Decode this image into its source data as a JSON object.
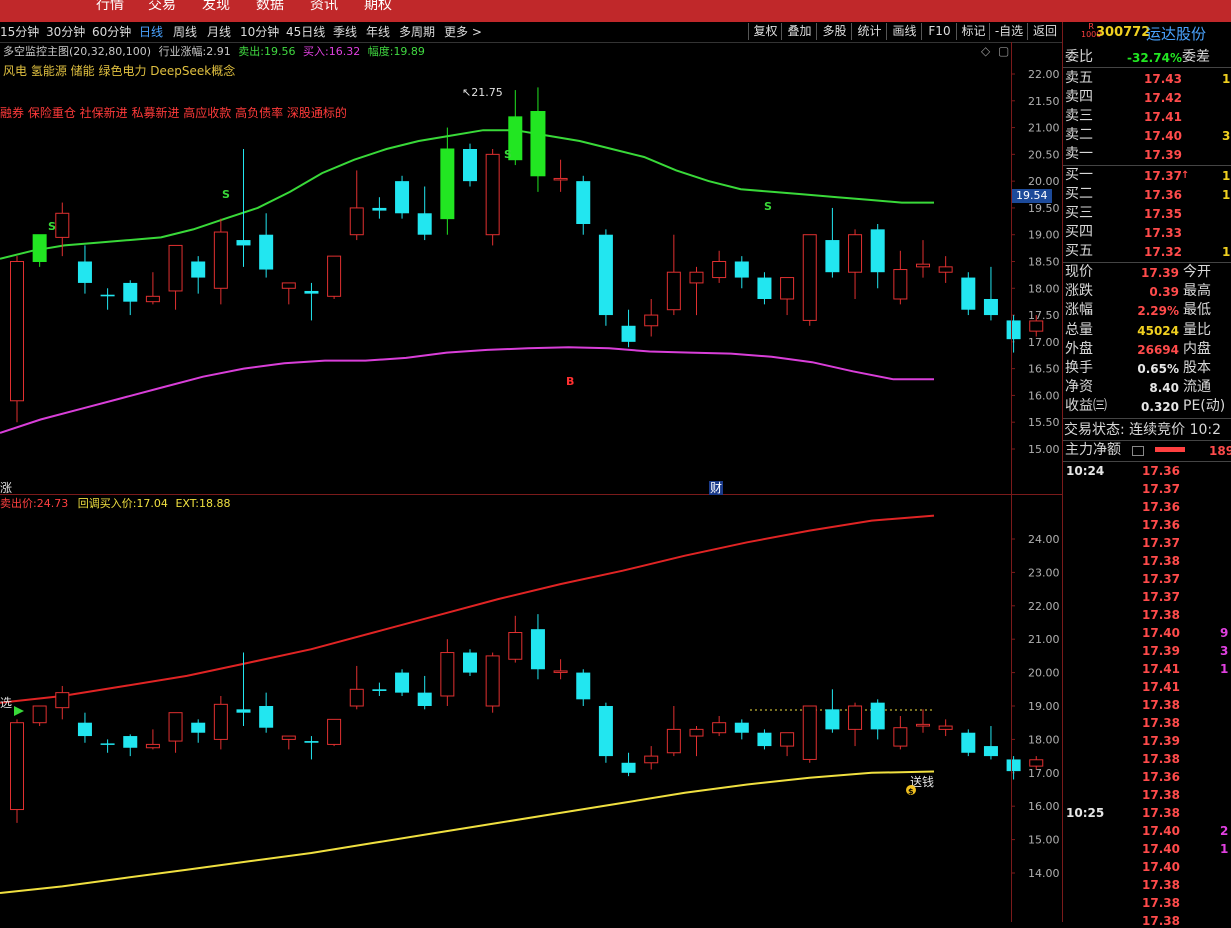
{
  "top_nav": {
    "items": [
      "行情",
      "交易",
      "发现",
      "数据",
      "资讯",
      "期权"
    ]
  },
  "periods": [
    "15分钟",
    "30分钟",
    "60分钟",
    "日线",
    "周线",
    "月线",
    "10分钟",
    "45日线",
    "季线",
    "年线",
    "多周期",
    "更多 >"
  ],
  "active_period": "日线",
  "tools": [
    "复权",
    "叠加",
    "多股",
    "统计",
    "画线",
    "F10",
    "标记",
    "-自选",
    "返回"
  ],
  "main_chart": {
    "indicator_name": "多空监控主图(20,32,80,100)",
    "indicator_rise_label": "行业涨幅:",
    "indicator_rise_value": "2.91",
    "sell_label": "卖出:",
    "sell_value": "19.56",
    "buy_label": "买入:",
    "buy_value": "16.32",
    "range_label": "幅度:",
    "range_value": "19.89",
    "concepts_line1": "风电 氢能源 储能 绿色电力 DeepSeek概念",
    "concepts_line2": "融券 保险重仓 社保新进 私募新进 高应收款 高负债率 深股通标的",
    "high_marker": "21.75",
    "current_price_tag": "19.54",
    "cai_marker": "财",
    "zhang_marker": "涨"
  },
  "sub_chart": {
    "sell_price_label": "卖出价:",
    "sell_price_value": "24.73",
    "pullback_label": "回调买入价:",
    "pullback_value": "17.04",
    "ext_label": "EXT:",
    "ext_value": "18.88",
    "pick_marker": "选",
    "money_marker": "送钱",
    "coin_marker": "$"
  },
  "chart_data": [
    {
      "type": "candlestick",
      "ylim": [
        14.6,
        22.3
      ],
      "yticks": [
        "22.00",
        "21.50",
        "21.00",
        "20.50",
        "20.00",
        "19.50",
        "19.00",
        "18.50",
        "18.00",
        "17.50",
        "17.00",
        "16.50",
        "16.00",
        "15.50",
        "15.00"
      ],
      "candles": [
        {
          "o": 15.9,
          "h": 18.6,
          "l": 15.5,
          "c": 18.5
        },
        {
          "o": 18.5,
          "h": 19.0,
          "l": 18.4,
          "c": 19.0
        },
        {
          "o": 18.95,
          "h": 19.6,
          "l": 18.6,
          "c": 19.4
        },
        {
          "o": 18.5,
          "h": 18.8,
          "l": 17.9,
          "c": 18.1
        },
        {
          "o": 17.88,
          "h": 18.0,
          "l": 17.6,
          "c": 17.85
        },
        {
          "o": 18.1,
          "h": 18.15,
          "l": 17.5,
          "c": 17.75
        },
        {
          "o": 17.75,
          "h": 18.3,
          "l": 17.7,
          "c": 17.85
        },
        {
          "o": 17.95,
          "h": 18.8,
          "l": 17.6,
          "c": 18.8
        },
        {
          "o": 18.5,
          "h": 18.6,
          "l": 17.9,
          "c": 18.2
        },
        {
          "o": 18.0,
          "h": 19.3,
          "l": 17.7,
          "c": 19.05
        },
        {
          "o": 18.9,
          "h": 20.6,
          "l": 18.4,
          "c": 18.8
        },
        {
          "o": 19.0,
          "h": 19.4,
          "l": 18.2,
          "c": 18.35
        },
        {
          "o": 18.0,
          "h": 18.1,
          "l": 17.7,
          "c": 18.1
        },
        {
          "o": 17.95,
          "h": 18.1,
          "l": 17.4,
          "c": 17.9
        },
        {
          "o": 17.85,
          "h": 18.6,
          "l": 17.8,
          "c": 18.6
        },
        {
          "o": 19.0,
          "h": 20.2,
          "l": 18.9,
          "c": 19.5
        },
        {
          "o": 19.5,
          "h": 19.7,
          "l": 19.3,
          "c": 19.45
        },
        {
          "o": 20.0,
          "h": 20.1,
          "l": 19.3,
          "c": 19.4
        },
        {
          "o": 19.4,
          "h": 19.9,
          "l": 18.9,
          "c": 19.0
        },
        {
          "o": 19.3,
          "h": 21.0,
          "l": 19.0,
          "c": 20.6
        },
        {
          "o": 20.6,
          "h": 20.7,
          "l": 19.9,
          "c": 20.0
        },
        {
          "o": 19.0,
          "h": 20.6,
          "l": 18.8,
          "c": 20.5
        },
        {
          "o": 20.4,
          "h": 21.7,
          "l": 20.3,
          "c": 21.2
        },
        {
          "o": 21.3,
          "h": 21.75,
          "l": 19.8,
          "c": 20.1
        },
        {
          "o": 20.05,
          "h": 20.4,
          "l": 19.8,
          "c": 20.05
        },
        {
          "o": 20.0,
          "h": 20.1,
          "l": 19.0,
          "c": 19.2
        },
        {
          "o": 19.0,
          "h": 19.1,
          "l": 17.3,
          "c": 17.5
        },
        {
          "o": 17.3,
          "h": 17.6,
          "l": 16.9,
          "c": 17.0
        },
        {
          "o": 17.3,
          "h": 17.8,
          "l": 17.1,
          "c": 17.5
        },
        {
          "o": 17.6,
          "h": 19.0,
          "l": 17.5,
          "c": 18.3
        },
        {
          "o": 18.1,
          "h": 18.4,
          "l": 17.5,
          "c": 18.3
        },
        {
          "o": 18.2,
          "h": 18.7,
          "l": 18.1,
          "c": 18.5
        },
        {
          "o": 18.5,
          "h": 18.6,
          "l": 18.0,
          "c": 18.2
        },
        {
          "o": 18.2,
          "h": 18.3,
          "l": 17.7,
          "c": 17.8
        },
        {
          "o": 17.8,
          "h": 18.2,
          "l": 17.5,
          "c": 18.2
        },
        {
          "o": 17.4,
          "h": 19.0,
          "l": 17.3,
          "c": 19.0
        },
        {
          "o": 18.9,
          "h": 19.5,
          "l": 18.2,
          "c": 18.3
        },
        {
          "o": 18.3,
          "h": 19.1,
          "l": 17.8,
          "c": 19.0
        },
        {
          "o": 19.1,
          "h": 19.2,
          "l": 18.0,
          "c": 18.3
        },
        {
          "o": 17.8,
          "h": 18.7,
          "l": 17.7,
          "c": 18.35
        },
        {
          "o": 18.4,
          "h": 18.9,
          "l": 18.2,
          "c": 18.45
        },
        {
          "o": 18.3,
          "h": 18.6,
          "l": 18.1,
          "c": 18.4
        },
        {
          "o": 18.2,
          "h": 18.3,
          "l": 17.5,
          "c": 17.6
        },
        {
          "o": 17.8,
          "h": 18.4,
          "l": 17.4,
          "c": 17.5
        },
        {
          "o": 17.4,
          "h": 17.5,
          "l": 16.8,
          "c": 17.05
        },
        {
          "o": 17.2,
          "h": 17.5,
          "l": 17.1,
          "c": 17.39
        }
      ],
      "series": [
        {
          "values": [
            18.55,
            18.7,
            18.8,
            18.85,
            18.9,
            18.95,
            19.1,
            19.3,
            19.5,
            19.8,
            20.15,
            20.4,
            20.6,
            20.75,
            20.85,
            20.95,
            20.95,
            20.85,
            20.75,
            20.6,
            20.45,
            20.2,
            20.0,
            19.85,
            19.8,
            19.75,
            19.7,
            19.65,
            19.6,
            19.6
          ]
        },
        {
          "values": [
            15.3,
            15.55,
            15.75,
            15.95,
            16.15,
            16.35,
            16.5,
            16.6,
            16.65,
            16.65,
            16.7,
            16.8,
            16.85,
            16.88,
            16.9,
            16.88,
            16.82,
            16.8,
            16.78,
            16.72,
            16.62,
            16.45,
            16.3,
            16.3
          ]
        }
      ],
      "markers": [
        "S",
        "S",
        "S",
        "S",
        "B"
      ]
    },
    {
      "type": "candlestick",
      "ylim": [
        13.3,
        25.0
      ],
      "yticks": [
        "24.00",
        "23.00",
        "22.00",
        "21.00",
        "20.00",
        "19.00",
        "18.00",
        "17.00",
        "16.00",
        "15.00",
        "14.00"
      ],
      "series": [
        {
          "name": "卖出价",
          "values": [
            19.1,
            19.3,
            19.6,
            19.9,
            20.3,
            20.7,
            21.2,
            21.7,
            22.2,
            22.65,
            23.05,
            23.5,
            23.9,
            24.25,
            24.55,
            24.7
          ]
        },
        {
          "name": "回调买入价",
          "values": [
            13.4,
            13.6,
            13.85,
            14.1,
            14.35,
            14.6,
            14.9,
            15.2,
            15.5,
            15.8,
            16.1,
            16.4,
            16.65,
            16.85,
            17.0,
            17.04
          ]
        }
      ],
      "ext_line": 18.88
    }
  ],
  "right_panel": {
    "code": "300772",
    "name": "运达股份",
    "r_mark": "R",
    "rank_mark": "1000",
    "wei_bi_label": "委比",
    "wei_bi_value": "-32.74%",
    "wei_cha_label": "委差",
    "asks": [
      {
        "label": "卖五",
        "price": "17.43",
        "vol": "1"
      },
      {
        "label": "卖四",
        "price": "17.42",
        "vol": ""
      },
      {
        "label": "卖三",
        "price": "17.41",
        "vol": ""
      },
      {
        "label": "卖二",
        "price": "17.40",
        "vol": "3"
      },
      {
        "label": "卖一",
        "price": "17.39",
        "vol": ""
      }
    ],
    "bids": [
      {
        "label": "买一",
        "price": "17.37",
        "vol": "1"
      },
      {
        "label": "买二",
        "price": "17.36",
        "vol": "1"
      },
      {
        "label": "买三",
        "price": "17.35",
        "vol": ""
      },
      {
        "label": "买四",
        "price": "17.33",
        "vol": ""
      },
      {
        "label": "买五",
        "price": "17.32",
        "vol": "1"
      }
    ],
    "stats": [
      {
        "label": "现价",
        "value": "17.39",
        "label2": "今开",
        "color": "#ff4b4b"
      },
      {
        "label": "涨跌",
        "value": "0.39",
        "label2": "最高",
        "color": "#ff4b4b"
      },
      {
        "label": "涨幅",
        "value": "2.29%",
        "label2": "最低",
        "color": "#ff4b4b"
      },
      {
        "label": "总量",
        "value": "45024",
        "label2": "量比",
        "color": "#f0d020"
      },
      {
        "label": "外盘",
        "value": "26694",
        "label2": "内盘",
        "color": "#ff4b4b"
      },
      {
        "label": "换手",
        "value": "0.65%",
        "label2": "股本",
        "color": "#e6e6e6"
      },
      {
        "label": "净资",
        "value": "8.40",
        "label2": "流通",
        "color": "#e6e6e6"
      },
      {
        "label": "收益㈢",
        "value": "0.320",
        "label2": "PE(动)",
        "color": "#e6e6e6"
      }
    ],
    "trade_status": "交易状态: 连续竞价 10:2",
    "main_flow_label": "主力净额",
    "main_flow_value": "189",
    "ticks": [
      {
        "time": "10:24",
        "price": "17.36",
        "vol": ""
      },
      {
        "time": "",
        "price": "17.37",
        "vol": ""
      },
      {
        "time": "",
        "price": "17.36",
        "vol": ""
      },
      {
        "time": "",
        "price": "17.36",
        "vol": ""
      },
      {
        "time": "",
        "price": "17.37",
        "vol": ""
      },
      {
        "time": "",
        "price": "17.38",
        "vol": ""
      },
      {
        "time": "",
        "price": "17.37",
        "vol": ""
      },
      {
        "time": "",
        "price": "17.37",
        "vol": ""
      },
      {
        "time": "",
        "price": "17.38",
        "vol": ""
      },
      {
        "time": "",
        "price": "17.40",
        "vol": "9"
      },
      {
        "time": "",
        "price": "17.39",
        "vol": "3"
      },
      {
        "time": "",
        "price": "17.41",
        "vol": "1"
      },
      {
        "time": "",
        "price": "17.41",
        "vol": ""
      },
      {
        "time": "",
        "price": "17.38",
        "vol": ""
      },
      {
        "time": "",
        "price": "17.38",
        "vol": ""
      },
      {
        "time": "",
        "price": "17.39",
        "vol": ""
      },
      {
        "time": "",
        "price": "17.38",
        "vol": ""
      },
      {
        "time": "",
        "price": "17.36",
        "vol": ""
      },
      {
        "time": "",
        "price": "17.38",
        "vol": ""
      },
      {
        "time": "10:25",
        "price": "17.38",
        "vol": ""
      },
      {
        "time": "",
        "price": "17.40",
        "vol": "2"
      },
      {
        "time": "",
        "price": "17.40",
        "vol": "1"
      },
      {
        "time": "",
        "price": "17.40",
        "vol": ""
      },
      {
        "time": "",
        "price": "17.38",
        "vol": ""
      },
      {
        "time": "",
        "price": "17.38",
        "vol": ""
      },
      {
        "time": "",
        "price": "17.38",
        "vol": ""
      }
    ]
  }
}
